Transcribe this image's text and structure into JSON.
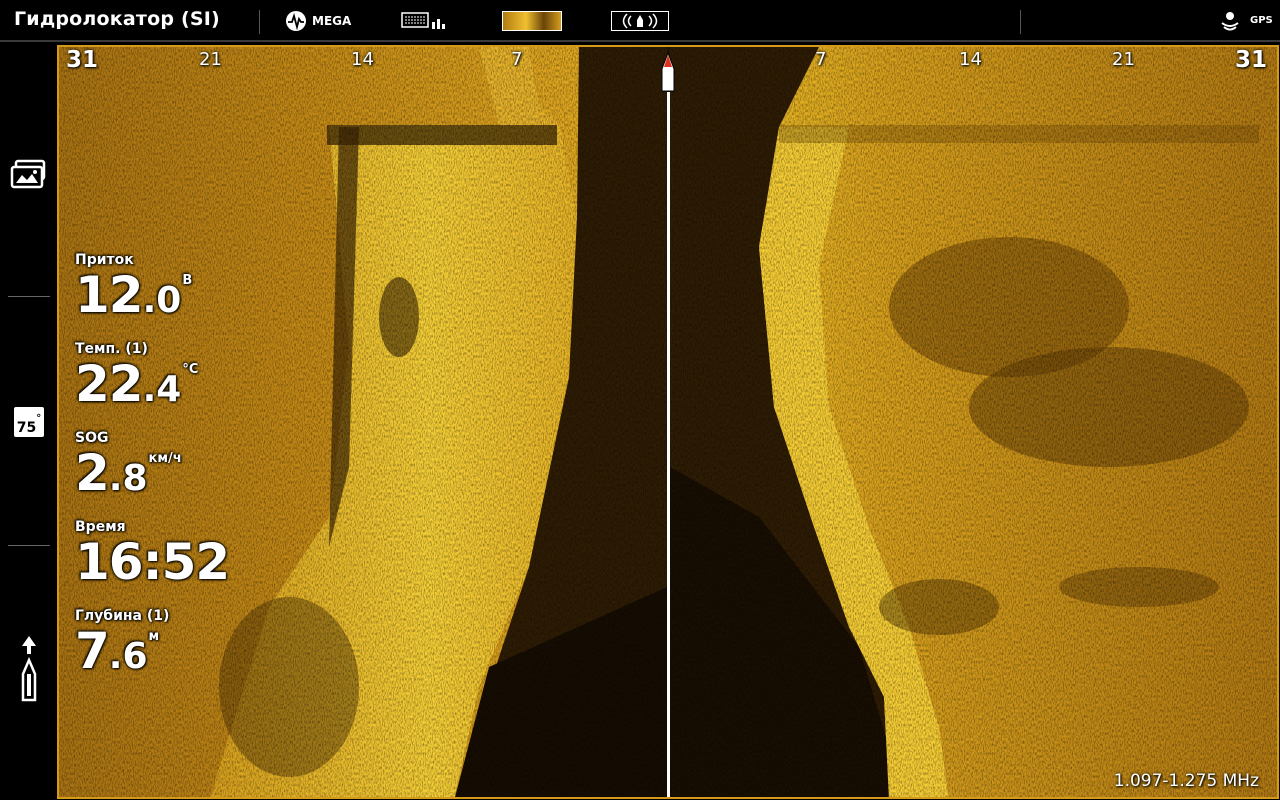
{
  "topbar": {
    "title": "Гидролокатор (SI)",
    "mega_label": "MEGA",
    "gps_label": "GPS"
  },
  "icons": {
    "mega": "sonar-pulse-icon",
    "chart_combo": "chart-sonar-combo-icon",
    "side_image_thumb": "side-imaging-thumbnail-icon",
    "transducer": "transducer-beam-icon",
    "gps": "gps-status-icon",
    "views": "views-icon",
    "beam_angle": "beam-angle-icon",
    "boat": "boat-icon"
  },
  "sidebar": {
    "beam_angle": "75"
  },
  "sonar": {
    "range_left": [
      "31",
      "21",
      "14",
      "7"
    ],
    "range_right": [
      "7",
      "14",
      "21",
      "31"
    ],
    "frequency": "1.097-1.275 MHz"
  },
  "readouts": [
    {
      "label": "Приток",
      "int": "12",
      "dec": ".0",
      "unit": "В"
    },
    {
      "label": "Темп. (1)",
      "int": "22",
      "dec": ".4",
      "unit": "°C"
    },
    {
      "label": "SOG",
      "int": "2",
      "dec": ".8",
      "unit": "км/ч"
    },
    {
      "label": "Время",
      "int": "16:52",
      "dec": "",
      "unit": ""
    },
    {
      "label": "Глубина (1)",
      "int": "7",
      "dec": ".6",
      "unit": "м"
    }
  ],
  "colors": {
    "accent": "#d59a1a",
    "sonar_bright": "#f2c020",
    "sonar_dark": "#2a1a04"
  }
}
